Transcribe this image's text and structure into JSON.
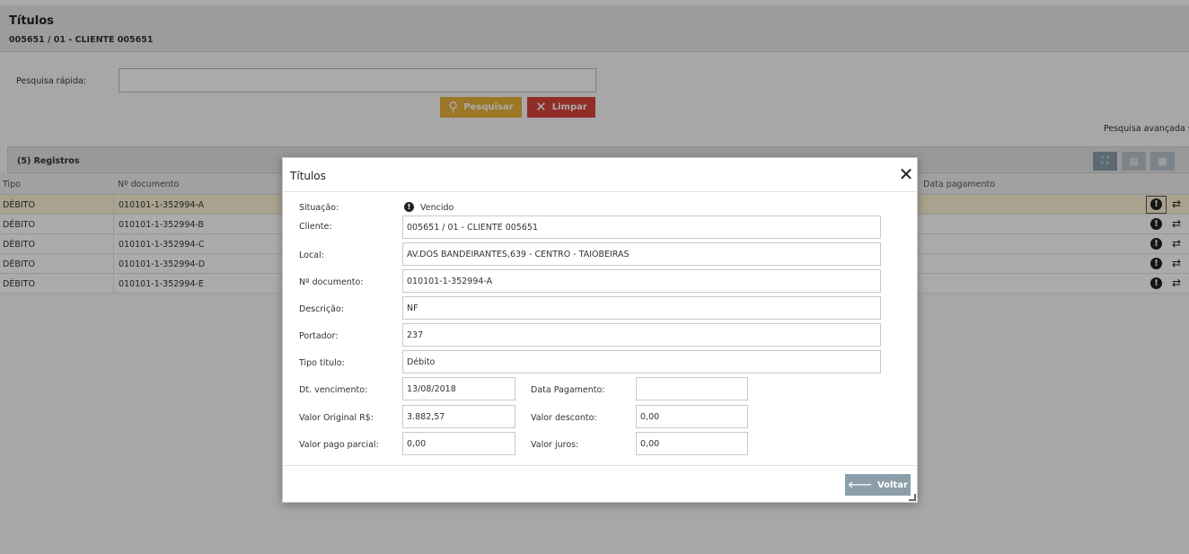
{
  "page": {
    "title": "Títulos",
    "subtitle": "005651 / 01 - CLIENTE 005651"
  },
  "search": {
    "label": "Pesquisa rápida:",
    "value": "",
    "search_button": "Pesquisar",
    "clear_button": "Limpar",
    "advanced": "Pesquisa avançada"
  },
  "panel": {
    "title": "(5) Registros"
  },
  "grid": {
    "columns": {
      "tipo": "Tipo",
      "documento": "Nº documento",
      "data_pagamento": "Data pagamento"
    },
    "rows": [
      {
        "tipo": "DÉBITO",
        "documento": "010101-1-352994-A",
        "selected": true
      },
      {
        "tipo": "DÉBITO",
        "documento": "010101-1-352994-B"
      },
      {
        "tipo": "DÉBITO",
        "documento": "010101-1-352994-C"
      },
      {
        "tipo": "DÉBITO",
        "documento": "010101-1-352994-D"
      },
      {
        "tipo": "DÉBITO",
        "documento": "010101-1-352994-E"
      }
    ]
  },
  "icons": {
    "search": "search-icon",
    "clear": "close-icon",
    "status": "exclamation-circle-icon",
    "swap": "swap-arrows-icon",
    "back": "arrow-left-icon"
  },
  "colors": {
    "search_button": "#e8b23a",
    "clear_button": "#d9433a",
    "secondary_button": "#8d9eab",
    "selected_row": "#fbf2d4"
  },
  "modal": {
    "title": "Títulos",
    "fields": {
      "situacao": {
        "label": "Situação:",
        "value": "Vencido"
      },
      "cliente": {
        "label": "Cliente:",
        "value": "005651 / 01 - CLIENTE 005651"
      },
      "local": {
        "label": "Local:",
        "value": "AV.DOS BANDEIRANTES,639 - CENTRO - TAIOBEIRAS"
      },
      "documento": {
        "label": "Nº documento:",
        "value": "010101-1-352994-A"
      },
      "descricao": {
        "label": "Descrição:",
        "value": "NF"
      },
      "portador": {
        "label": "Portador:",
        "value": "237"
      },
      "tipo_titulo": {
        "label": "Tipo titulo:",
        "value": "Débito"
      },
      "vencimento": {
        "label": "Dt. vencimento:",
        "value": "13/08/2018"
      },
      "data_pagamento": {
        "label": "Data Pagamento:",
        "value": ""
      },
      "valor_original": {
        "label": "Valor Original R$:",
        "value": "3.882,57"
      },
      "valor_desconto": {
        "label": "Valor desconto:",
        "value": "0,00"
      },
      "valor_pago_parcial": {
        "label": "Valor pago parcial:",
        "value": "0,00"
      },
      "valor_juros": {
        "label": "Valor juros:",
        "value": "0,00"
      }
    },
    "back_button": "Voltar"
  }
}
